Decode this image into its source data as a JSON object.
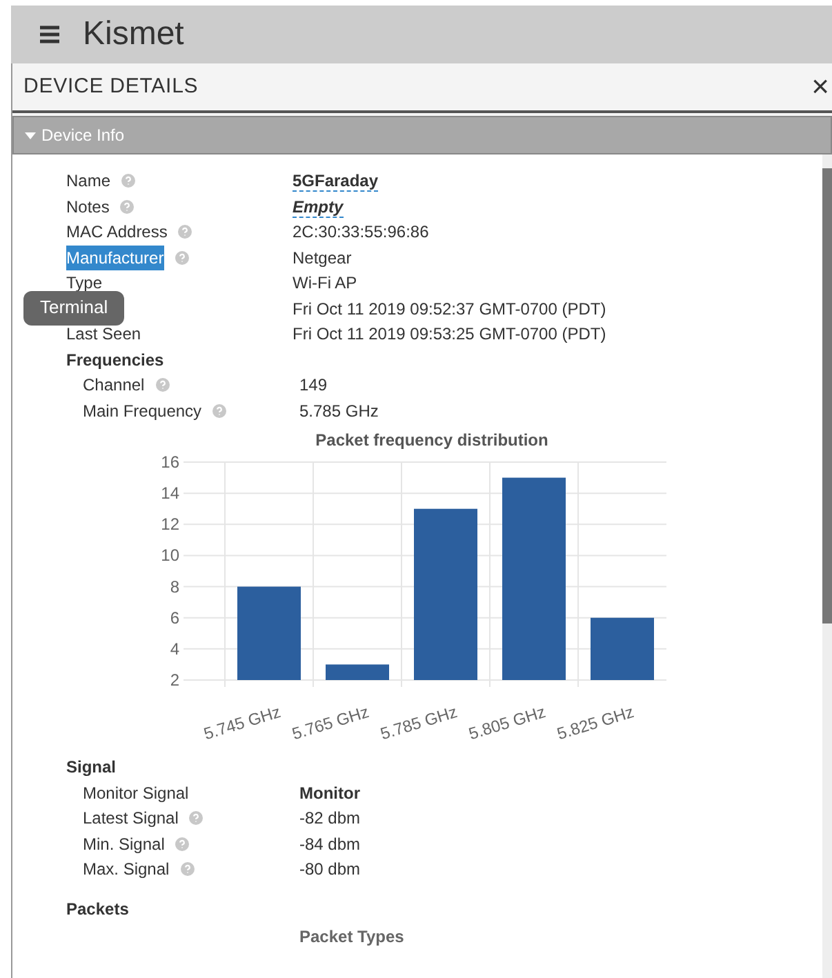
{
  "app": {
    "title": "Kismet"
  },
  "dialog": {
    "title": "DEVICE DETAILS",
    "close": "×"
  },
  "section": {
    "title": "Device Info",
    "expanded": true
  },
  "fields": [
    {
      "label": "Name",
      "help": true,
      "value": "5GFaraday",
      "kind": "editable",
      "bold": true,
      "italic": false
    },
    {
      "label": "Notes",
      "help": true,
      "value": "Empty",
      "kind": "editable",
      "bold": true,
      "italic": true
    },
    {
      "label": "MAC Address",
      "help": true,
      "value": "2C:30:33:55:96:86",
      "kind": "plain",
      "bold": false,
      "italic": false
    },
    {
      "label": "Manufacturer",
      "help": true,
      "value": "Netgear",
      "kind": "plain",
      "bold": false,
      "italic": false,
      "selected": true
    },
    {
      "label": "Type",
      "help": false,
      "value": "Wi-Fi AP",
      "kind": "plain",
      "bold": false,
      "italic": false
    },
    {
      "value": "Fri Oct 11 2019 09:52:37 GMT-0700 (PDT)",
      "help": false,
      "kind": "plain",
      "bold": false,
      "italic": false
    },
    {
      "label": "Last Seen",
      "help": false,
      "value": "Fri Oct 11 2019 09:53:25 GMT-0700 (PDT)",
      "kind": "plain",
      "bold": false,
      "italic": false
    }
  ],
  "tooltip": {
    "text": "Terminal"
  },
  "frequencies": {
    "title": "Frequencies",
    "rows": [
      {
        "label": "Channel",
        "help": true,
        "value": "149"
      },
      {
        "label": "Main Frequency",
        "help": true,
        "value": "5.785 GHz"
      }
    ],
    "chart_data": {
      "type": "bar",
      "title": "Packet frequency distribution",
      "categories": [
        "5.745 GHz",
        "5.765 GHz",
        "5.785 GHz",
        "5.805 GHz",
        "5.825 GHz"
      ],
      "series": [
        {
          "color": "#2c5f9e",
          "values": [
            8,
            3,
            13,
            15,
            6
          ]
        }
      ],
      "ylim": [
        2,
        16
      ],
      "yticks": [
        2,
        4,
        6,
        8,
        10,
        12,
        14,
        16
      ],
      "grid": true
    }
  },
  "signal": {
    "title": "Signal",
    "rows": [
      {
        "label": "Monitor Signal",
        "help": false,
        "value": "Monitor",
        "bold": true
      },
      {
        "label": "Latest Signal",
        "help": true,
        "value": "-82 dbm",
        "bold": false
      },
      {
        "label": "Min. Signal",
        "help": true,
        "value": "-84 dbm",
        "bold": false
      },
      {
        "label": "Max. Signal",
        "help": true,
        "value": "-80 dbm",
        "bold": false
      }
    ]
  },
  "packets": {
    "title": "Packets",
    "subtitle": "Packet Types"
  }
}
